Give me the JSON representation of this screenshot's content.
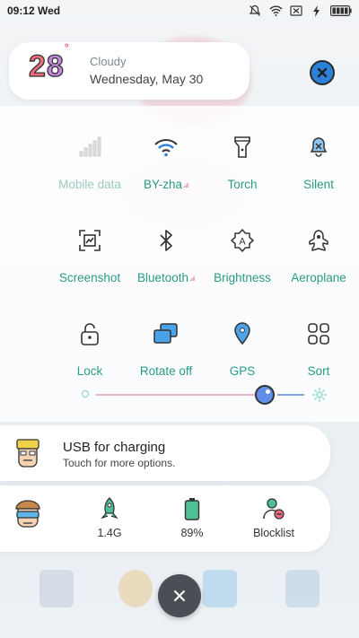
{
  "status_bar": {
    "time_day": "09:12 Wed"
  },
  "weather": {
    "temp_digit1": "2",
    "temp_digit2": "8",
    "degree_symbol": "°",
    "condition": "Cloudy",
    "date": "Wednesday, May 30"
  },
  "toggles": [
    {
      "label": "Mobile data",
      "icon": "signal-bars-icon",
      "muted": true
    },
    {
      "label": "BY-zha",
      "icon": "wifi-icon",
      "has_more": true
    },
    {
      "label": "Torch",
      "icon": "torch-icon"
    },
    {
      "label": "Silent",
      "icon": "silent-bell-icon"
    },
    {
      "label": "Screenshot",
      "icon": "screenshot-icon"
    },
    {
      "label": "Bluetooth",
      "icon": "bluetooth-icon",
      "has_more": true
    },
    {
      "label": "Brightness",
      "icon": "auto-brightness-icon"
    },
    {
      "label": "Aeroplane",
      "icon": "aeroplane-icon"
    },
    {
      "label": "Lock",
      "icon": "lock-icon"
    },
    {
      "label": "Rotate off",
      "icon": "rotate-icon"
    },
    {
      "label": "GPS",
      "icon": "gps-icon"
    },
    {
      "label": "Sort",
      "icon": "sort-grid-icon"
    }
  ],
  "brightness": {
    "level": 0.78
  },
  "usb_notification": {
    "title": "USB for charging",
    "subtitle": "Touch for more options."
  },
  "bottom_stats": {
    "network": "1.4G",
    "battery": "89%",
    "blocklist": "Blocklist"
  },
  "colors": {
    "accent_teal": "#2a9a86",
    "muted_teal": "#9fc9c2",
    "wifi_blue": "#2c80d8",
    "brightness_knob": "#5f8fe6"
  }
}
